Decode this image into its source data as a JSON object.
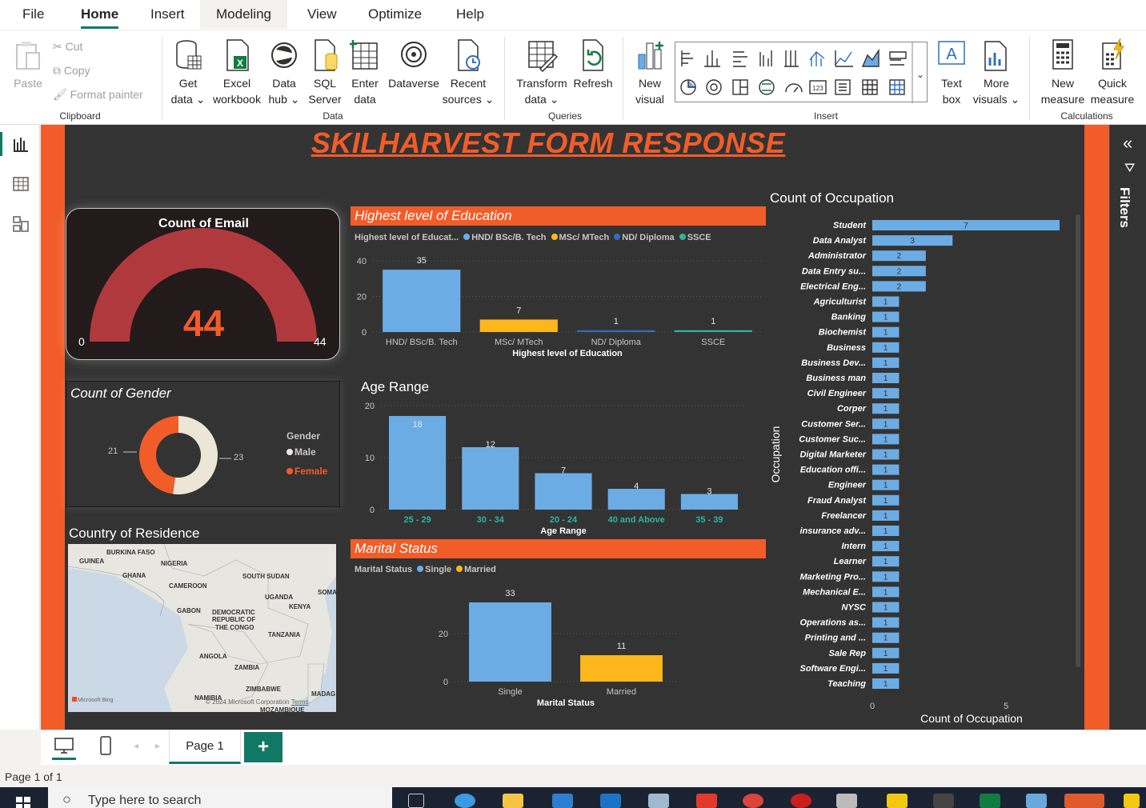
{
  "menu": {
    "file": "File",
    "home": "Home",
    "insert": "Insert",
    "modeling": "Modeling",
    "view": "View",
    "optimize": "Optimize",
    "help": "Help"
  },
  "ribbon": {
    "clipboard": {
      "paste": "Paste",
      "cut": "Cut",
      "copy": "Copy",
      "format_painter": "Format painter",
      "label": "Clipboard"
    },
    "data": {
      "get_data": [
        "Get",
        "data"
      ],
      "excel_workbook": [
        "Excel",
        "workbook"
      ],
      "data_hub": [
        "Data",
        "hub"
      ],
      "sql_server": [
        "SQL",
        "Server"
      ],
      "enter_data": [
        "Enter",
        "data"
      ],
      "dataverse": "Dataverse",
      "recent_sources": [
        "Recent",
        "sources"
      ],
      "label": "Data"
    },
    "queries": {
      "transform_data": [
        "Transform",
        "data"
      ],
      "refresh": "Refresh",
      "label": "Queries"
    },
    "insert": {
      "new_visual": [
        "New",
        "visual"
      ],
      "text_box": [
        "Text",
        "box"
      ],
      "more_visuals": [
        "More",
        "visuals"
      ],
      "label": "Insert"
    },
    "calculations": {
      "new_measure": [
        "New",
        "measure"
      ],
      "quick_measure": [
        "Quick",
        "measure"
      ],
      "label": "Calculations"
    }
  },
  "filters_label": "Filters",
  "report": {
    "title": "SKILHARVEST FORM RESPONSE",
    "gauge": {
      "title": "Count of Email",
      "value": "44",
      "min": "0",
      "max": "44"
    },
    "gender": {
      "title": "Count of Gender",
      "legend_title": "Gender",
      "male": "Male",
      "female": "Female",
      "male_value": "23",
      "female_value": "21"
    },
    "map": {
      "title": "Country of Residence",
      "labels": [
        "BURKINA FASO",
        "GUINEA",
        "NIGERIA",
        "GHANA",
        "CAMEROON",
        "SOUTH SUDAN",
        "SOMA",
        "UGANDA",
        "KENYA",
        "GABON",
        "DEMOCRATIC",
        "REPUBLIC OF",
        "THE CONGO",
        "TANZANIA",
        "ANGOLA",
        "ZAMBIA",
        "ZIMBABWE",
        "MADAG",
        "NAMIBIA",
        "MOZAMBIQUE"
      ],
      "brand": "Microsoft Bing",
      "copyright": "© 2024 Microsoft Corporation",
      "terms": "Terms"
    },
    "education": {
      "title": "Highest level of Education",
      "legend_title": "Highest level of Educat...",
      "xlabel": "Highest level of Education"
    },
    "age": {
      "title": "Age Range",
      "xlabel": "Age Range"
    },
    "marital": {
      "title": "Marital Status",
      "legend_title": "Marital Status",
      "xlabel": "Marital Status"
    },
    "occupation": {
      "title": "Count of Occupation",
      "ylabel": "Occupation",
      "xlabel": "Count of Occupation"
    }
  },
  "page_tab": "Page 1",
  "status": "Page 1 of 1",
  "taskbar": {
    "search_placeholder": "Type here to search"
  },
  "colors": {
    "accent": "#f25c29",
    "bar_blue": "#6cace4",
    "bar_yellow": "#fdb71a",
    "teal": "#2bb5a1",
    "gauge": "#b0393d",
    "donut_light": "#ece6d6"
  },
  "chart_data": [
    {
      "type": "bar",
      "title": "Highest level of Education",
      "xlabel": "Highest level of Education",
      "categories": [
        "HND/ BSc/B. Tech",
        "MSc/ MTech",
        "ND/ Diploma",
        "SSCE"
      ],
      "values": [
        35,
        7,
        1,
        1
      ],
      "legend": [
        "HND/ BSc/B. Tech",
        "MSc/ MTech",
        "ND/ Diploma",
        "SSCE"
      ],
      "colors": [
        "#6cace4",
        "#fdb71a",
        "#2f6ec1",
        "#2bb5a1"
      ],
      "yticks": [
        0,
        20,
        40
      ],
      "ylim": [
        0,
        40
      ]
    },
    {
      "type": "bar",
      "title": "Age Range",
      "xlabel": "Age Range",
      "categories": [
        "25 - 29",
        "30 - 34",
        "20 - 24",
        "40 and Above",
        "35 - 39"
      ],
      "values": [
        18,
        12,
        7,
        4,
        3
      ],
      "yticks": [
        0,
        10,
        20
      ],
      "ylim": [
        0,
        20
      ]
    },
    {
      "type": "bar",
      "title": "Marital Status",
      "xlabel": "Marital Status",
      "categories": [
        "Single",
        "Married"
      ],
      "values": [
        33,
        11
      ],
      "legend": [
        "Single",
        "Married"
      ],
      "colors": [
        "#6cace4",
        "#fdb71a"
      ],
      "yticks": [
        0,
        20
      ],
      "ylim": [
        0,
        40
      ]
    },
    {
      "type": "bar",
      "orientation": "horizontal",
      "title": "Count of Occupation",
      "xlabel": "Count of Occupation",
      "ylabel": "Occupation",
      "categories": [
        "Student",
        "Data Analyst",
        "Administrator",
        "Data Entry su...",
        "Electrical Eng...",
        "Agriculturist",
        "Banking",
        "Biochemist",
        "Business",
        "Business Dev...",
        "Business man",
        "Civil Engineer",
        "Corper",
        "Customer Ser...",
        "Customer Suc...",
        "Digital Marketer",
        "Education offi...",
        "Engineer",
        "Fraud Analyst",
        "Freelancer",
        "insurance adv...",
        "Intern",
        "Learner",
        "Marketing Pro...",
        "Mechanical E...",
        "NYSC",
        "Operations as...",
        "Printing and ...",
        "Sale Rep",
        "Software Engi...",
        "Teaching"
      ],
      "values": [
        7,
        3,
        2,
        2,
        2,
        1,
        1,
        1,
        1,
        1,
        1,
        1,
        1,
        1,
        1,
        1,
        1,
        1,
        1,
        1,
        1,
        1,
        1,
        1,
        1,
        1,
        1,
        1,
        1,
        1,
        1
      ],
      "xticks": [
        0,
        5
      ],
      "xlim": [
        0,
        7
      ]
    },
    {
      "type": "pie",
      "title": "Count of Gender",
      "categories": [
        "Male",
        "Female"
      ],
      "values": [
        23,
        21
      ],
      "colors": [
        "#ece6d6",
        "#f25c29"
      ]
    }
  ]
}
